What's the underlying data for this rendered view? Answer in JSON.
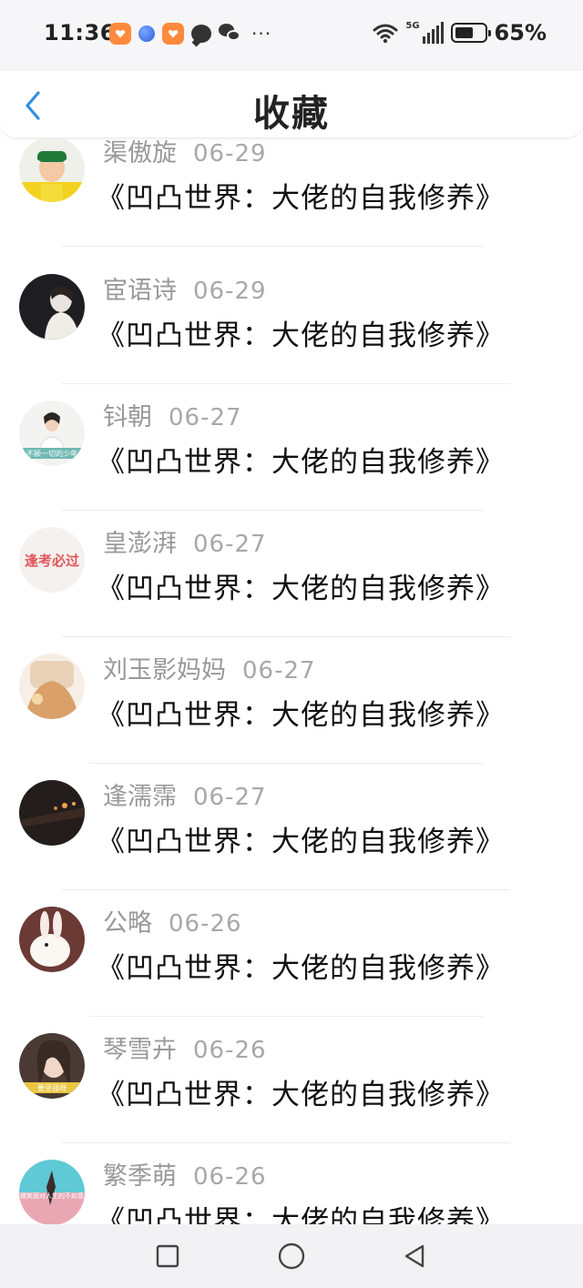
{
  "status": {
    "time": "11:36",
    "network": "5G",
    "battery": "65%"
  },
  "header": {
    "title": "收藏"
  },
  "list": [
    {
      "name": "渠傲旋",
      "date": "06-29",
      "title": "《凹凸世界：大佬的自我修养》"
    },
    {
      "name": "宦语诗",
      "date": "06-29",
      "title": "《凹凸世界：大佬的自我修养》"
    },
    {
      "name": "钭朝",
      "date": "06-27",
      "title": "《凹凸世界：大佬的自我修养》"
    },
    {
      "name": "皇澎湃",
      "date": "06-27",
      "title": "《凹凸世界：大佬的自我修养》"
    },
    {
      "name": "刘玉影妈妈",
      "date": "06-27",
      "title": "《凹凸世界：大佬的自我修养》"
    },
    {
      "name": "逢濡霈",
      "date": "06-27",
      "title": "《凹凸世界：大佬的自我修养》"
    },
    {
      "name": "公略",
      "date": "06-26",
      "title": "《凹凸世界：大佬的自我修养》"
    },
    {
      "name": "琴雪卉",
      "date": "06-26",
      "title": "《凹凸世界：大佬的自我修养》"
    },
    {
      "name": "繁季萌",
      "date": "06-26",
      "title": "《凹凸世界：大佬的自我修养》"
    }
  ],
  "avatar_texts": {
    "a3": "不顾一切的少年",
    "a4": "逢考必过",
    "a8": "要坚强呀",
    "a9": "微笑面对人生的不如意"
  }
}
